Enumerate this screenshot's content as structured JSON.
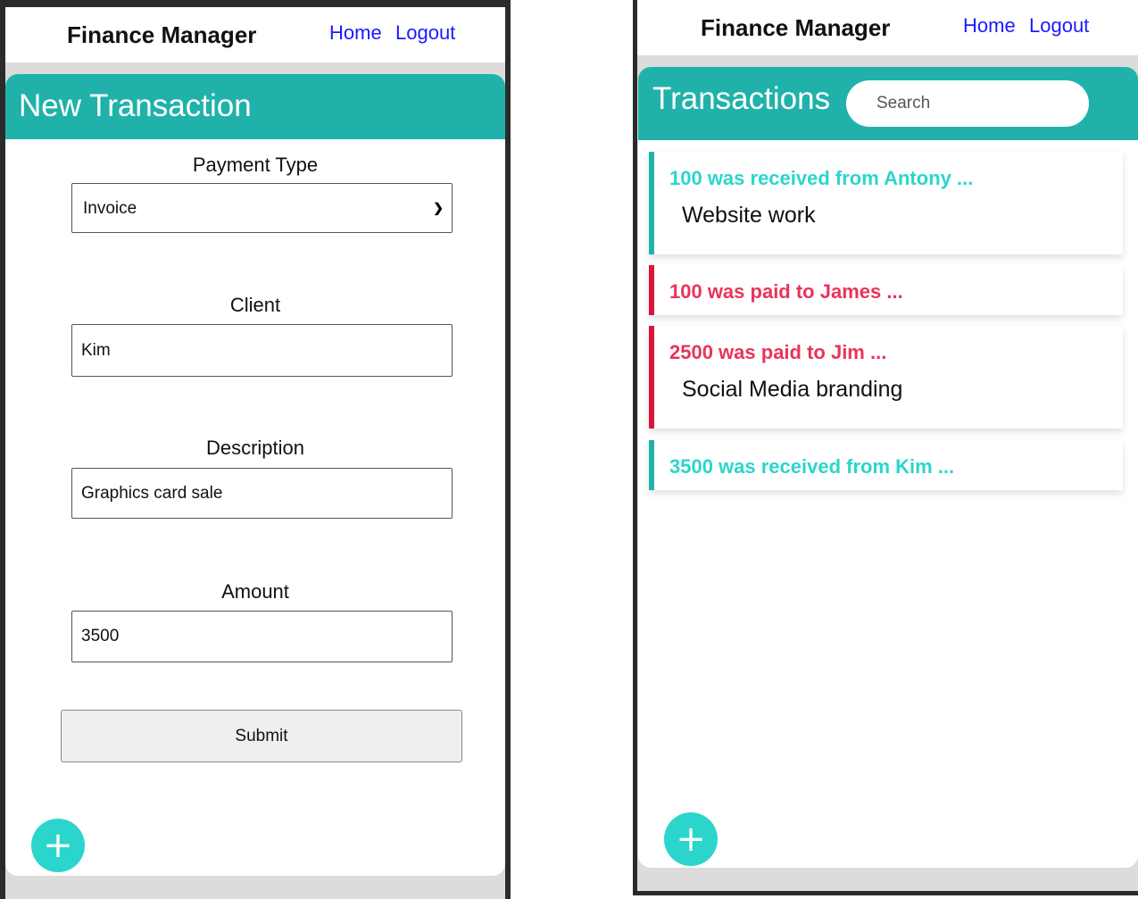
{
  "app": {
    "brand": "Finance Manager",
    "nav": {
      "home": "Home",
      "logout": "Logout"
    }
  },
  "new_transaction": {
    "title": "New Transaction",
    "payment_type": {
      "label": "Payment Type",
      "value": "Invoice",
      "options": [
        "Invoice"
      ]
    },
    "client": {
      "label": "Client",
      "value": "Kim"
    },
    "description": {
      "label": "Description",
      "value": "Graphics card sale"
    },
    "amount": {
      "label": "Amount",
      "value": "3500"
    },
    "submit_label": "Submit",
    "fab_label": "+"
  },
  "transactions": {
    "title": "Transactions",
    "search_placeholder": "Search",
    "items": [
      {
        "type": "received",
        "heading": "100 was received from Antony ...",
        "description": "Website work"
      },
      {
        "type": "paid",
        "heading": "100 was paid to James ...",
        "description": ""
      },
      {
        "type": "paid",
        "heading": "2500 was paid to Jim ...",
        "description": "Social Media branding"
      },
      {
        "type": "received",
        "heading": "3500 was received from Kim ...",
        "description": ""
      }
    ],
    "fab_label": "+"
  },
  "colors": {
    "accent": "#20b2aa",
    "fab": "#2bd5cc",
    "paid": "#dc143c",
    "link": "#1a1aff"
  }
}
